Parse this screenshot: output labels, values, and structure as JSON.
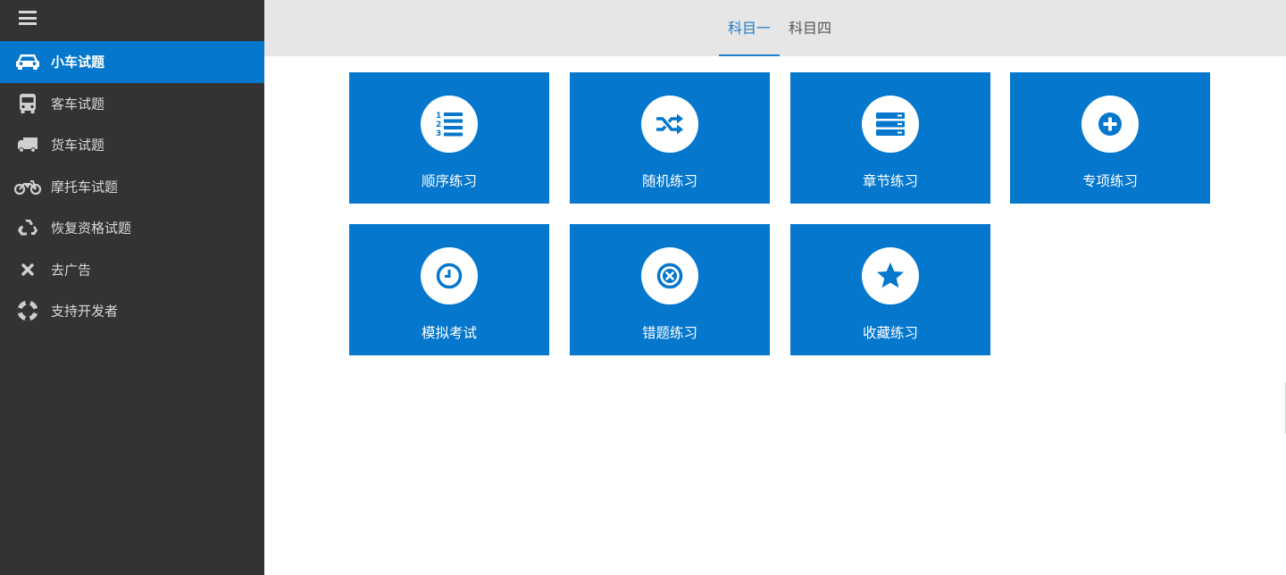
{
  "sidebar": {
    "menu_icon": "hamburger-menu-icon",
    "items": [
      {
        "label": "小车试题",
        "icon": "car-icon",
        "active": true
      },
      {
        "label": "客车试题",
        "icon": "bus-icon",
        "active": false
      },
      {
        "label": "货车试题",
        "icon": "truck-icon",
        "active": false
      },
      {
        "label": "摩托车试题",
        "icon": "motorcycle-icon",
        "active": false
      },
      {
        "label": "恢复资格试题",
        "icon": "recycle-icon",
        "active": false
      },
      {
        "label": "去广告",
        "icon": "close-icon",
        "active": false
      },
      {
        "label": "支持开发者",
        "icon": "lifebuoy-icon",
        "active": false
      }
    ]
  },
  "tabs": [
    {
      "label": "科目一",
      "active": true
    },
    {
      "label": "科目四",
      "active": false
    }
  ],
  "tiles": [
    {
      "label": "顺序练习",
      "icon": "ordered-list-icon"
    },
    {
      "label": "随机练习",
      "icon": "shuffle-icon"
    },
    {
      "label": "章节练习",
      "icon": "server-stack-icon"
    },
    {
      "label": "专项练习",
      "icon": "plus-circle-icon"
    },
    {
      "label": "模拟考试",
      "icon": "clock-icon"
    },
    {
      "label": "错题练习",
      "icon": "close-circle-icon"
    },
    {
      "label": "收藏练习",
      "icon": "star-icon"
    }
  ],
  "colors": {
    "accent": "#0577cc",
    "sidebar_bg": "#333333",
    "topbar_bg": "#e6e6e6",
    "tab_active": "#1f7ecb"
  }
}
